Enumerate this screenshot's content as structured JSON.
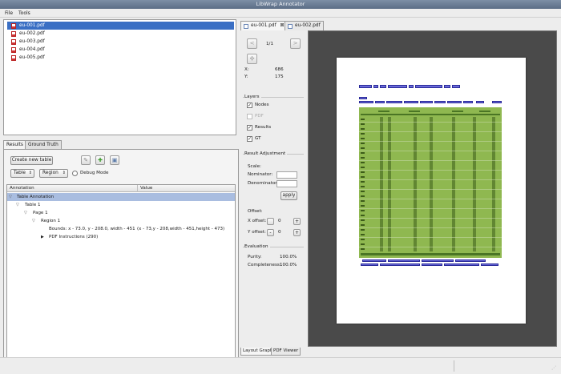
{
  "window": {
    "title": "LibWrap Annotator"
  },
  "menu": [
    "File",
    "Tools"
  ],
  "files": [
    "eu-001.pdf",
    "eu-002.pdf",
    "eu-003.pdf",
    "eu-004.pdf",
    "eu-005.pdf"
  ],
  "selected_file_index": 0,
  "left_tabs": [
    "Results",
    "Ground Truth"
  ],
  "toolbar": {
    "create_button": "Create new table",
    "pencil_icon": "✎",
    "add_icon": "✚",
    "save_icon": "▣",
    "combo_type": "Table",
    "combo_level": "Region",
    "debug_label": "Debug Mode"
  },
  "tree": {
    "columns": [
      "Annotation",
      "Value"
    ],
    "rows": [
      {
        "label": "Table Annotation",
        "indent": 0,
        "expanded": true,
        "selected": true
      },
      {
        "label": "Table 1",
        "indent": 1,
        "expanded": true
      },
      {
        "label": "Page 1",
        "indent": 2,
        "expanded": true
      },
      {
        "label": "Region 1",
        "indent": 3,
        "expanded": true
      },
      {
        "label": "Bounds: x - 73.0, y - 208.0, width - 451.0, h",
        "value": "(x - 73,y - 208,width - 451,height - 473)",
        "indent": 4
      },
      {
        "label": "PDF Instructions (290)",
        "indent": 4,
        "collapsed": true
      }
    ]
  },
  "doc_tabs": [
    {
      "label": "eu-001.pdf",
      "active": true,
      "close": "⊠"
    },
    {
      "label": "eu-002.pdf",
      "active": false
    }
  ],
  "nav": {
    "prev": "<",
    "next": ">",
    "page": "1/1",
    "crosshair": "⊹"
  },
  "coords": {
    "x_label": "X:",
    "x_value": "686",
    "y_label": "Y:",
    "y_value": "175"
  },
  "layers": {
    "title": "Layers",
    "items": [
      {
        "label": "Nodes",
        "checked": true,
        "enabled": true
      },
      {
        "label": "PDF",
        "checked": false,
        "enabled": false
      },
      {
        "label": "Results",
        "checked": true,
        "enabled": true
      },
      {
        "label": "GT",
        "checked": true,
        "enabled": true
      }
    ]
  },
  "result_adjustment": {
    "title": "Result Adjustment",
    "scale_label": "Scale:",
    "nominator_label": "Nominator:",
    "denominator_label": "Denominator:",
    "apply_label": "apply",
    "offset_label": "Offset:",
    "x_offset_label": "X offset:",
    "x_offset_value": "0",
    "y_offset_label": "Y offset:",
    "y_offset_value": "0"
  },
  "evaluation": {
    "title": "Evaluation",
    "purity_label": "Purity:",
    "purity_value": "100.0%",
    "completeness_label": "Completeness:",
    "completeness_value": "100.0%"
  },
  "bottom_tabs": [
    "Layout Graph",
    "PDF Viewer"
  ],
  "colors": {
    "selection": "#3a6fc4",
    "region": "#8fb850",
    "node": "#6a6ad8"
  }
}
